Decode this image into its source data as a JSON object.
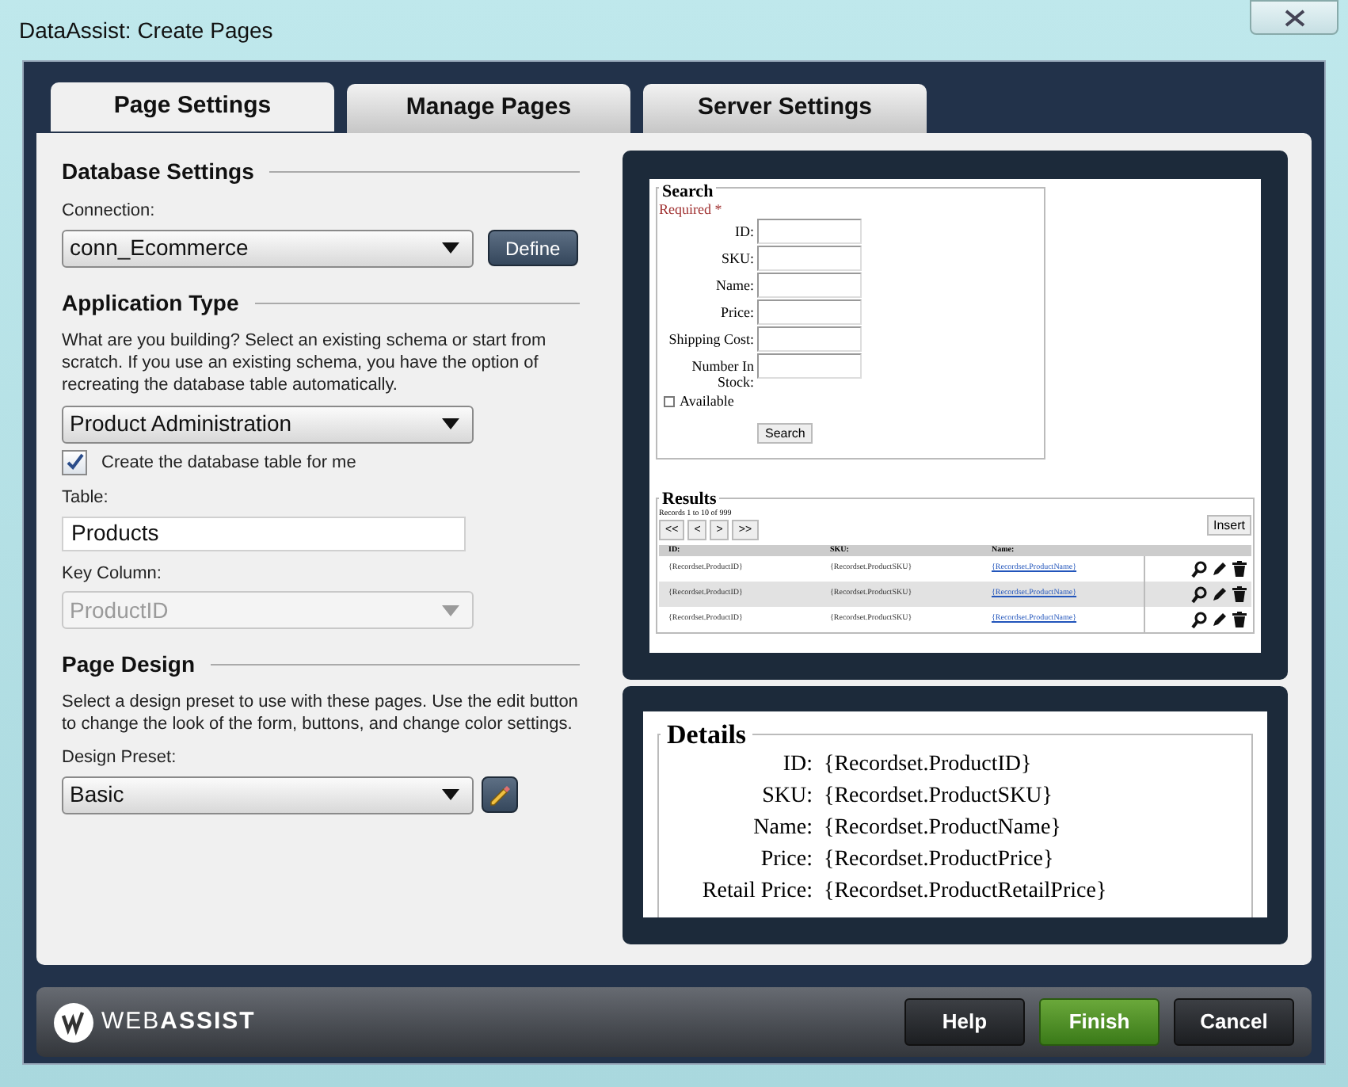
{
  "window": {
    "title": "DataAssist: Create Pages"
  },
  "tabs": [
    {
      "label": "Page Settings",
      "selected": true
    },
    {
      "label": "Manage Pages",
      "selected": false
    },
    {
      "label": "Server Settings",
      "selected": false
    }
  ],
  "sections": [
    {
      "title": "Database Settings",
      "fields": [
        {
          "kind": "select",
          "label": "Connection:",
          "value": "conn_Ecommerce",
          "disabled": false,
          "button": {
            "kind": "text",
            "label": "Define"
          }
        }
      ]
    },
    {
      "title": "Application Type",
      "description": "What are you building? Select an existing schema or start from scratch. If you use an existing schema, you have the option of recreating the database table automatically.",
      "fields": [
        {
          "kind": "select",
          "value": "Product Administration",
          "disabled": false
        },
        {
          "kind": "checkbox",
          "label": "Create the database table for me",
          "checked": true
        },
        {
          "kind": "input",
          "label": "Table:",
          "value": "Products"
        },
        {
          "kind": "select",
          "label": "Key Column:",
          "value": "ProductID",
          "disabled": true
        }
      ]
    },
    {
      "title": "Page Design",
      "description": "Select a design preset to use with these pages. Use the edit button to change the look of the form, buttons, and change color settings.",
      "fields": [
        {
          "kind": "select",
          "label": "Design Preset:",
          "value": "Basic",
          "disabled": false,
          "button": {
            "kind": "edit"
          }
        }
      ]
    }
  ],
  "preview": {
    "search": {
      "title": "Search",
      "required": "Required *",
      "fields": [
        "ID:",
        "SKU:",
        "Name:",
        "Price:",
        "Shipping Cost:",
        "Number In Stock:"
      ],
      "checkbox": {
        "label": "Available",
        "checked": false
      },
      "button": "Search"
    },
    "results": {
      "title": "Results",
      "records": "Records 1 to 10 of 999",
      "pager": [
        "<<",
        "<",
        ">",
        ">>"
      ],
      "insert": "Insert",
      "columns": [
        "ID:",
        "SKU:",
        "Name:"
      ],
      "rows": [
        [
          "{Recordset.ProductID}",
          "{Recordset.ProductSKU}",
          "{Recordset.ProductName}"
        ],
        [
          "{Recordset.ProductID}",
          "{Recordset.ProductSKU}",
          "{Recordset.ProductName}"
        ],
        [
          "{Recordset.ProductID}",
          "{Recordset.ProductSKU}",
          "{Recordset.ProductName}"
        ]
      ]
    },
    "details": {
      "title": "Details",
      "rows": [
        {
          "label": "ID:",
          "value": "{Recordset.ProductID}"
        },
        {
          "label": "SKU:",
          "value": "{Recordset.ProductSKU}"
        },
        {
          "label": "Name:",
          "value": "{Recordset.ProductName}"
        },
        {
          "label": "Price:",
          "value": "{Recordset.ProductPrice}"
        },
        {
          "label": "Retail Price:",
          "value": "{Recordset.ProductRetailPrice}"
        }
      ]
    }
  },
  "footer": {
    "logo": "WEB**ASSIST**",
    "buttons": [
      {
        "label": "Help",
        "kind": "default"
      },
      {
        "label": "Finish",
        "kind": "primary"
      },
      {
        "label": "Cancel",
        "kind": "default"
      }
    ]
  }
}
